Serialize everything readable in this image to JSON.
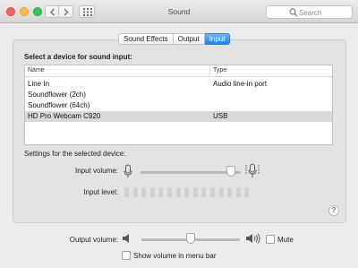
{
  "window": {
    "title": "Sound"
  },
  "search": {
    "placeholder": "Search"
  },
  "tabs": [
    {
      "label": "Sound Effects",
      "active": false
    },
    {
      "label": "Output",
      "active": false
    },
    {
      "label": "Input",
      "active": true
    }
  ],
  "input_panel": {
    "section_title": "Select a device for sound input:",
    "columns": [
      "Name",
      "Type"
    ],
    "devices": [
      {
        "name": "Line In",
        "type": "Audio line-in port",
        "selected": false
      },
      {
        "name": "Soundflower (2ch)",
        "type": "",
        "selected": false
      },
      {
        "name": "Soundflower (64ch)",
        "type": "",
        "selected": false
      },
      {
        "name": "HD Pro Webcam C920",
        "type": "USB",
        "selected": true
      }
    ],
    "settings_label": "Settings for the selected device:",
    "input_volume_label": "Input volume:",
    "input_volume_level": 0.9,
    "input_level_label": "Input level:",
    "input_level_segments": 15,
    "input_level_active": 0,
    "help_label": "?"
  },
  "output": {
    "volume_label": "Output volume:",
    "volume_level": 0.5,
    "mute_label": "Mute",
    "mute_checked": false,
    "show_volume_label": "Show volume in menu bar",
    "show_volume_checked": false
  },
  "icons": {
    "mic_low": "microphone-low-icon",
    "mic_high": "microphone-high-icon",
    "speaker_low": "speaker-low-icon",
    "speaker_high": "speaker-high-icon"
  },
  "colors": {
    "accent": "#1a82fb",
    "selected_row": "#d9d9d9"
  }
}
